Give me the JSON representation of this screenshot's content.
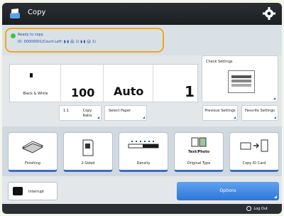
{
  "header": {
    "title": "Copy",
    "app_icon": "copy-app-icon",
    "settings_icon": "gear-icon"
  },
  "status": {
    "line1": "Ready to copy.",
    "line2": "ID: 00000001/Count Left: ▮ ▮ 🖨 1) ▮ ▮ 🖨 1)"
  },
  "summary": {
    "color_mode": "Black & White",
    "ratio_value": "100",
    "ratio_unit": "%",
    "paper": "Auto",
    "copies": "1"
  },
  "buttons": {
    "one_to_one": "1:1",
    "copy_ratio": "Copy Ratio",
    "select_paper": "Select Paper",
    "previous_settings": "Previous Settings",
    "favorite_settings": "Favorite Settings",
    "check_settings": "Check Settings"
  },
  "functions": [
    {
      "label": "Finishing",
      "icon": "stapler-icon"
    },
    {
      "label": "2-Sided",
      "icon": "two-sided-icon"
    },
    {
      "label": "Density",
      "icon": "density-icon"
    },
    {
      "label": "Original Type",
      "icon": "original-type-icon",
      "sub": "Text/Photo"
    },
    {
      "label": "Copy ID Card",
      "icon": "id-card-icon"
    }
  ],
  "bottom": {
    "interrupt": "Interrupt",
    "options": "Options",
    "logout": "Log Out"
  },
  "colors": {
    "accent": "#f2a61f",
    "primary_blue": "#2f76d7",
    "status_green": "#3ec63e"
  }
}
